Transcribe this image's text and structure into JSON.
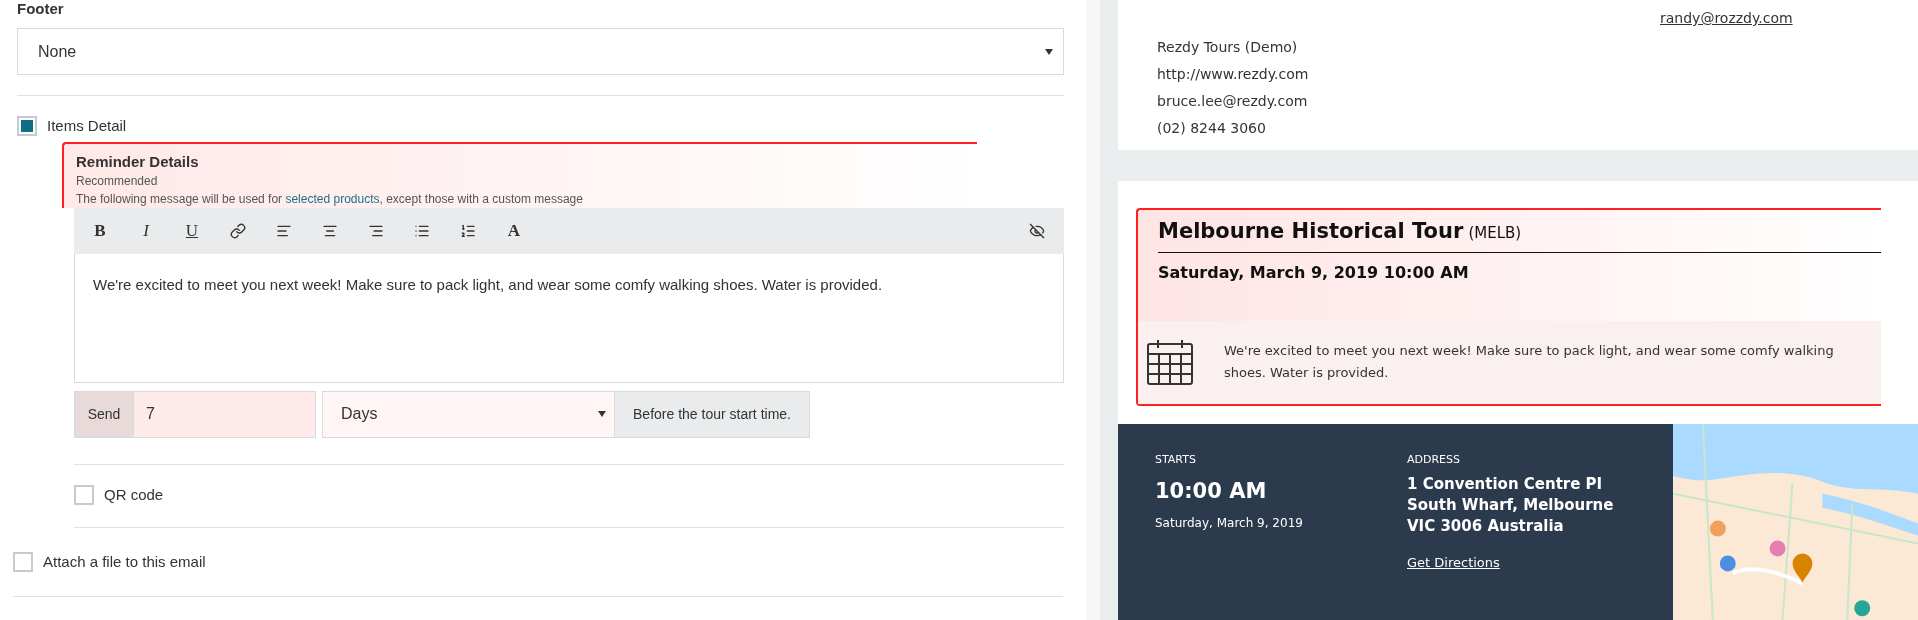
{
  "footer": {
    "label": "Footer",
    "value": "None"
  },
  "items_detail": {
    "label": "Items Detail",
    "checked": true
  },
  "reminder": {
    "title": "Reminder Details",
    "subtitle": "Recommended",
    "description_before": "The following message will be used for ",
    "link": "selected products",
    "description_after": ", except those with a custom message",
    "toolbar": [
      {
        "kind": "bold",
        "label": "B"
      },
      {
        "kind": "italic",
        "label": "I"
      },
      {
        "kind": "underline",
        "label": "U"
      },
      {
        "kind": "link"
      },
      {
        "kind": "align-left"
      },
      {
        "kind": "align-center"
      },
      {
        "kind": "align-right"
      },
      {
        "kind": "bullet-list"
      },
      {
        "kind": "numbered-list"
      },
      {
        "kind": "font",
        "label": "A"
      }
    ],
    "message": "We're excited to meet you next week! Make sure to pack light, and wear some comfy walking shoes. Water is provided.",
    "send": {
      "label": "Send",
      "value": "7",
      "unit": "Days",
      "suffix": "Before the tour start time."
    }
  },
  "qr_code": {
    "label": "QR code",
    "checked": false
  },
  "attach_file": {
    "label": "Attach a file to this email",
    "checked": false
  },
  "preview": {
    "email": "randy@rozzdy.com",
    "company": [
      "Rezdy Tours (Demo)",
      "http://www.rezdy.com",
      "bruce.lee@rezdy.com",
      "(02) 8244 3060"
    ],
    "tour": {
      "name": "Melbourne Historical Tour",
      "code": "(MELB)",
      "datetime": "Saturday, March 9, 2019 10:00 AM",
      "message": "We're excited to meet you next week! Make sure to pack light, and wear some comfy walking shoes. Water is provided."
    },
    "starts": {
      "label": "STARTS",
      "time": "10:00 AM",
      "date": "Saturday, March 9, 2019"
    },
    "address": {
      "label": "ADDRESS",
      "lines": [
        "1 Convention Centre PI",
        "South Wharf, Melbourne",
        "VIC 3006 Australia"
      ],
      "link": "Get Directions"
    }
  }
}
